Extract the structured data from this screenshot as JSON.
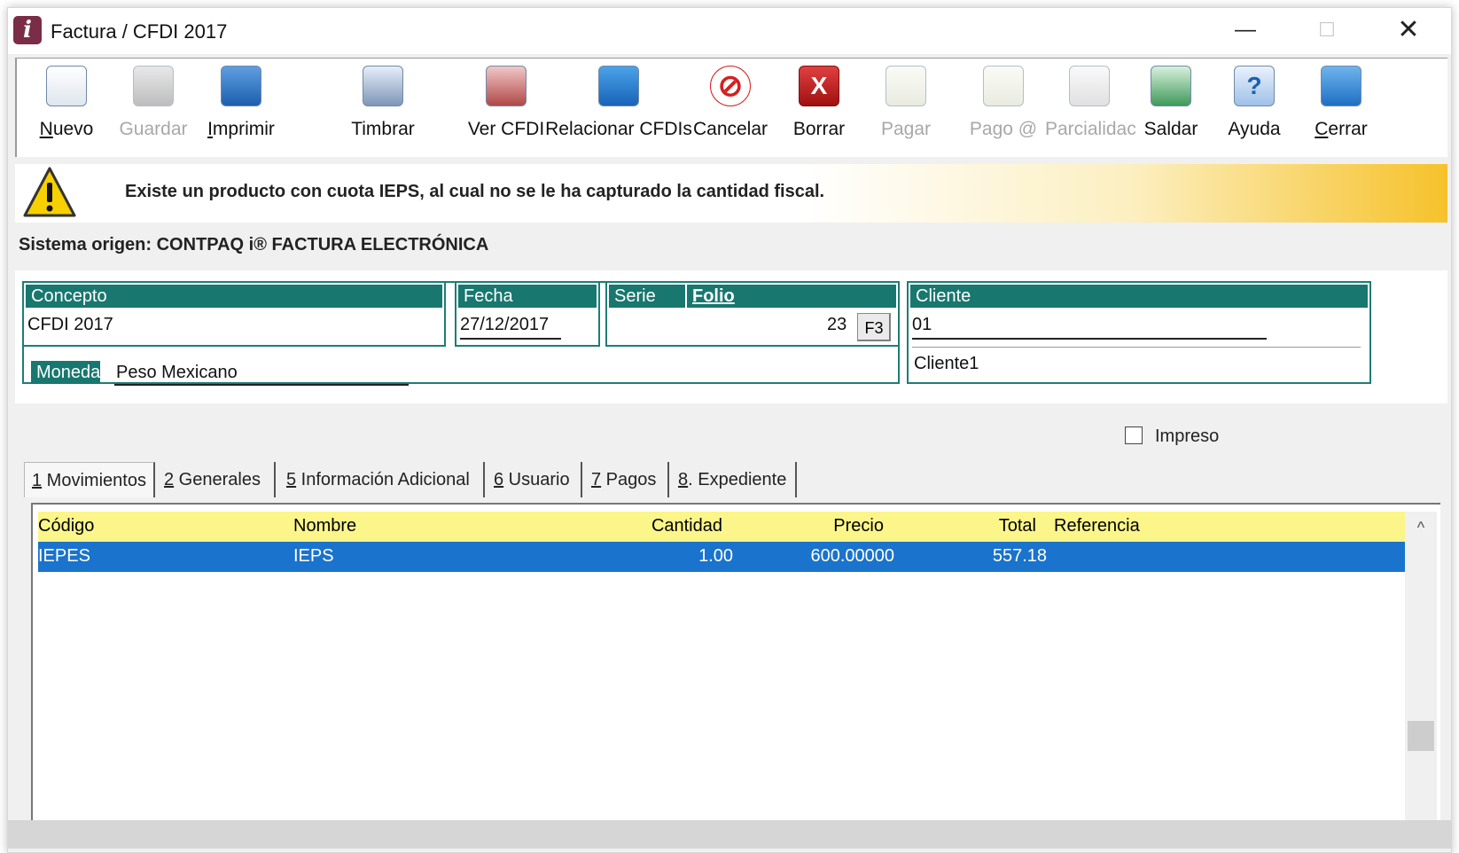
{
  "window": {
    "title": "Factura / CFDI 2017",
    "min_glyph": "—",
    "max_glyph": "☐",
    "close_glyph": "✕"
  },
  "toolbar": {
    "nuevo": "Nuevo",
    "guardar": "Guardar",
    "imprimir": "Imprimir",
    "timbrar": "Timbrar",
    "ver_cfdi": "Ver CFDI",
    "relacionar": "Relacionar CFDIs",
    "cancelar": "Cancelar",
    "borrar": "Borrar",
    "pagar": "Pagar",
    "pago_at": "Pago @",
    "parcialidad": "Parcialidac",
    "saldar": "Saldar",
    "ayuda": "Ayuda",
    "cerrar": "Cerrar",
    "icons": {
      "borrar_glyph": "X",
      "ayuda_glyph": "?",
      "cancelar_glyph": "⊘"
    }
  },
  "warning": {
    "text": "Existe un producto con cuota IEPS, al cual no se le ha capturado la cantidad fiscal."
  },
  "system_origin": "Sistema origen: CONTPAQ i® FACTURA ELECTRÓNICA",
  "header": {
    "concepto_label": "Concepto",
    "concepto_value": "CFDI 2017",
    "fecha_label": "Fecha",
    "fecha_value": "27/12/2017",
    "serie_label": "Serie",
    "folio_label": "Folio",
    "folio_value": "23",
    "f3_label": "F3",
    "moneda_label": "Moneda",
    "moneda_value": "Peso Mexicano",
    "cliente_label": "Cliente",
    "cliente_code": "01",
    "cliente_name": "Cliente1"
  },
  "impreso_label": "Impreso",
  "tabs": [
    {
      "num": "1",
      "label": " Movimientos"
    },
    {
      "num": "2",
      "label": " Generales"
    },
    {
      "num": "5",
      "label": " Información Adicional"
    },
    {
      "num": "6",
      "label": " Usuario"
    },
    {
      "num": "7",
      "label": " Pagos"
    },
    {
      "num": "8",
      "label": ". Expediente"
    }
  ],
  "grid": {
    "columns": {
      "codigo": "Código",
      "nombre": "Nombre",
      "cantidad": "Cantidad",
      "precio": "Precio",
      "total": "Total",
      "referencia": "Referencia"
    },
    "rows": [
      {
        "codigo": "IEPES",
        "nombre": "IEPS",
        "cantidad": "1.00",
        "precio": "600.00000",
        "total": "557.18",
        "referencia": ""
      }
    ],
    "scroll_up_glyph": "^"
  },
  "colors": {
    "teal": "#18776f",
    "selection": "#1a73cc",
    "grid_header": "#fbf58a",
    "warning": "#f6c22b"
  }
}
